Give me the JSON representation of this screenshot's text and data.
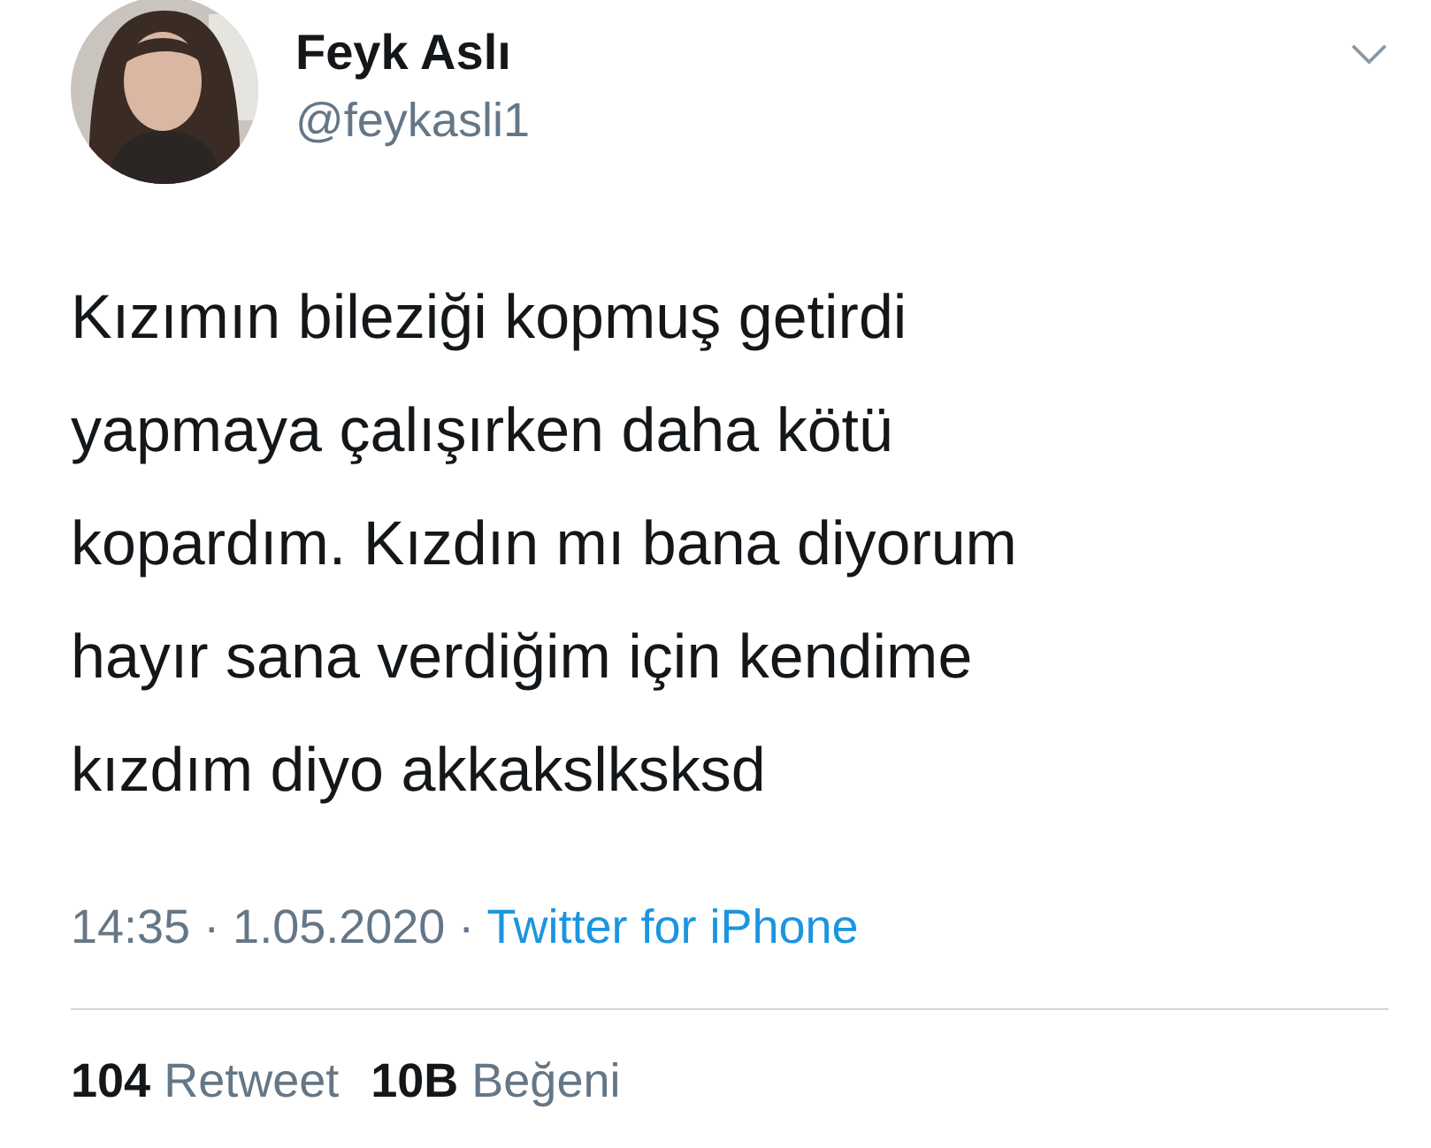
{
  "author": {
    "name": "Feyk Aslı",
    "handle": "@feykasli1"
  },
  "tweet": {
    "lines": [
      "Kızımın bileziği kopmuş getirdi",
      "yapmaya çalışırken daha kötü",
      "kopardım. Kızdın mı bana diyorum",
      "hayır sana verdiğim için kendime",
      "kızdım diyo akkakslksksd"
    ]
  },
  "meta": {
    "time": "14:35",
    "separators": [
      "·",
      "·"
    ],
    "date": "1.05.2020",
    "source": "Twitter for iPhone"
  },
  "stats": [
    {
      "count": "104",
      "label": "Retweet"
    },
    {
      "count": "10B",
      "label": "Beğeni"
    }
  ]
}
